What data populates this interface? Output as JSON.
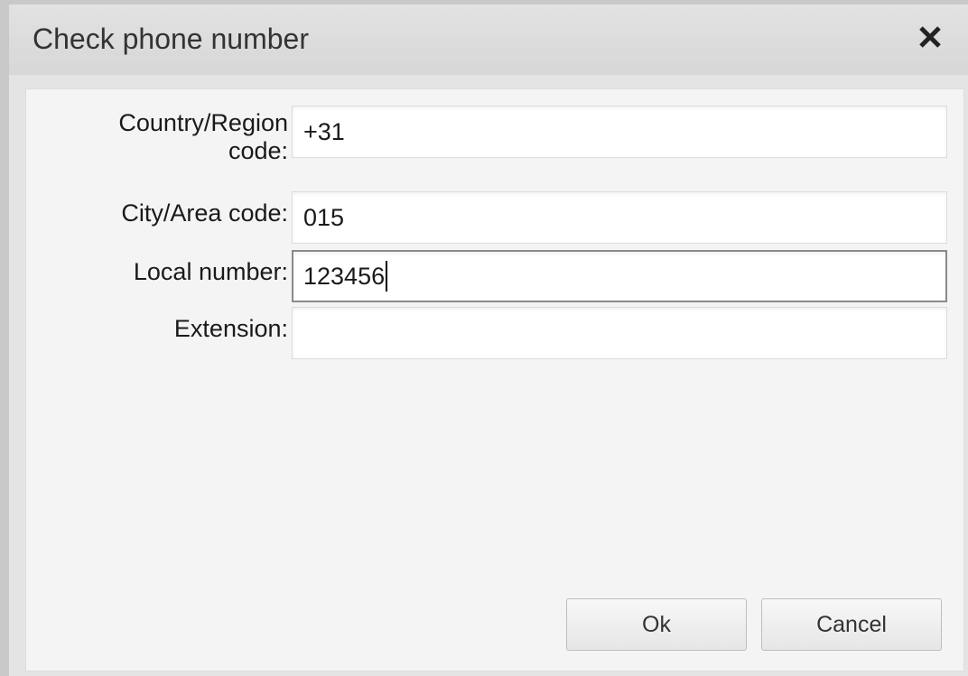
{
  "dialog": {
    "title": "Check phone number",
    "close_icon": "close-icon"
  },
  "form": {
    "country_label_line1": "Country/Region",
    "country_label_line2": "code:",
    "country_value": "+31",
    "city_label": "City/Area code:",
    "city_value": "015",
    "local_label": "Local number:",
    "local_value": "123456",
    "extension_label": "Extension:",
    "extension_value": ""
  },
  "buttons": {
    "ok_label": "Ok",
    "cancel_label": "Cancel"
  }
}
